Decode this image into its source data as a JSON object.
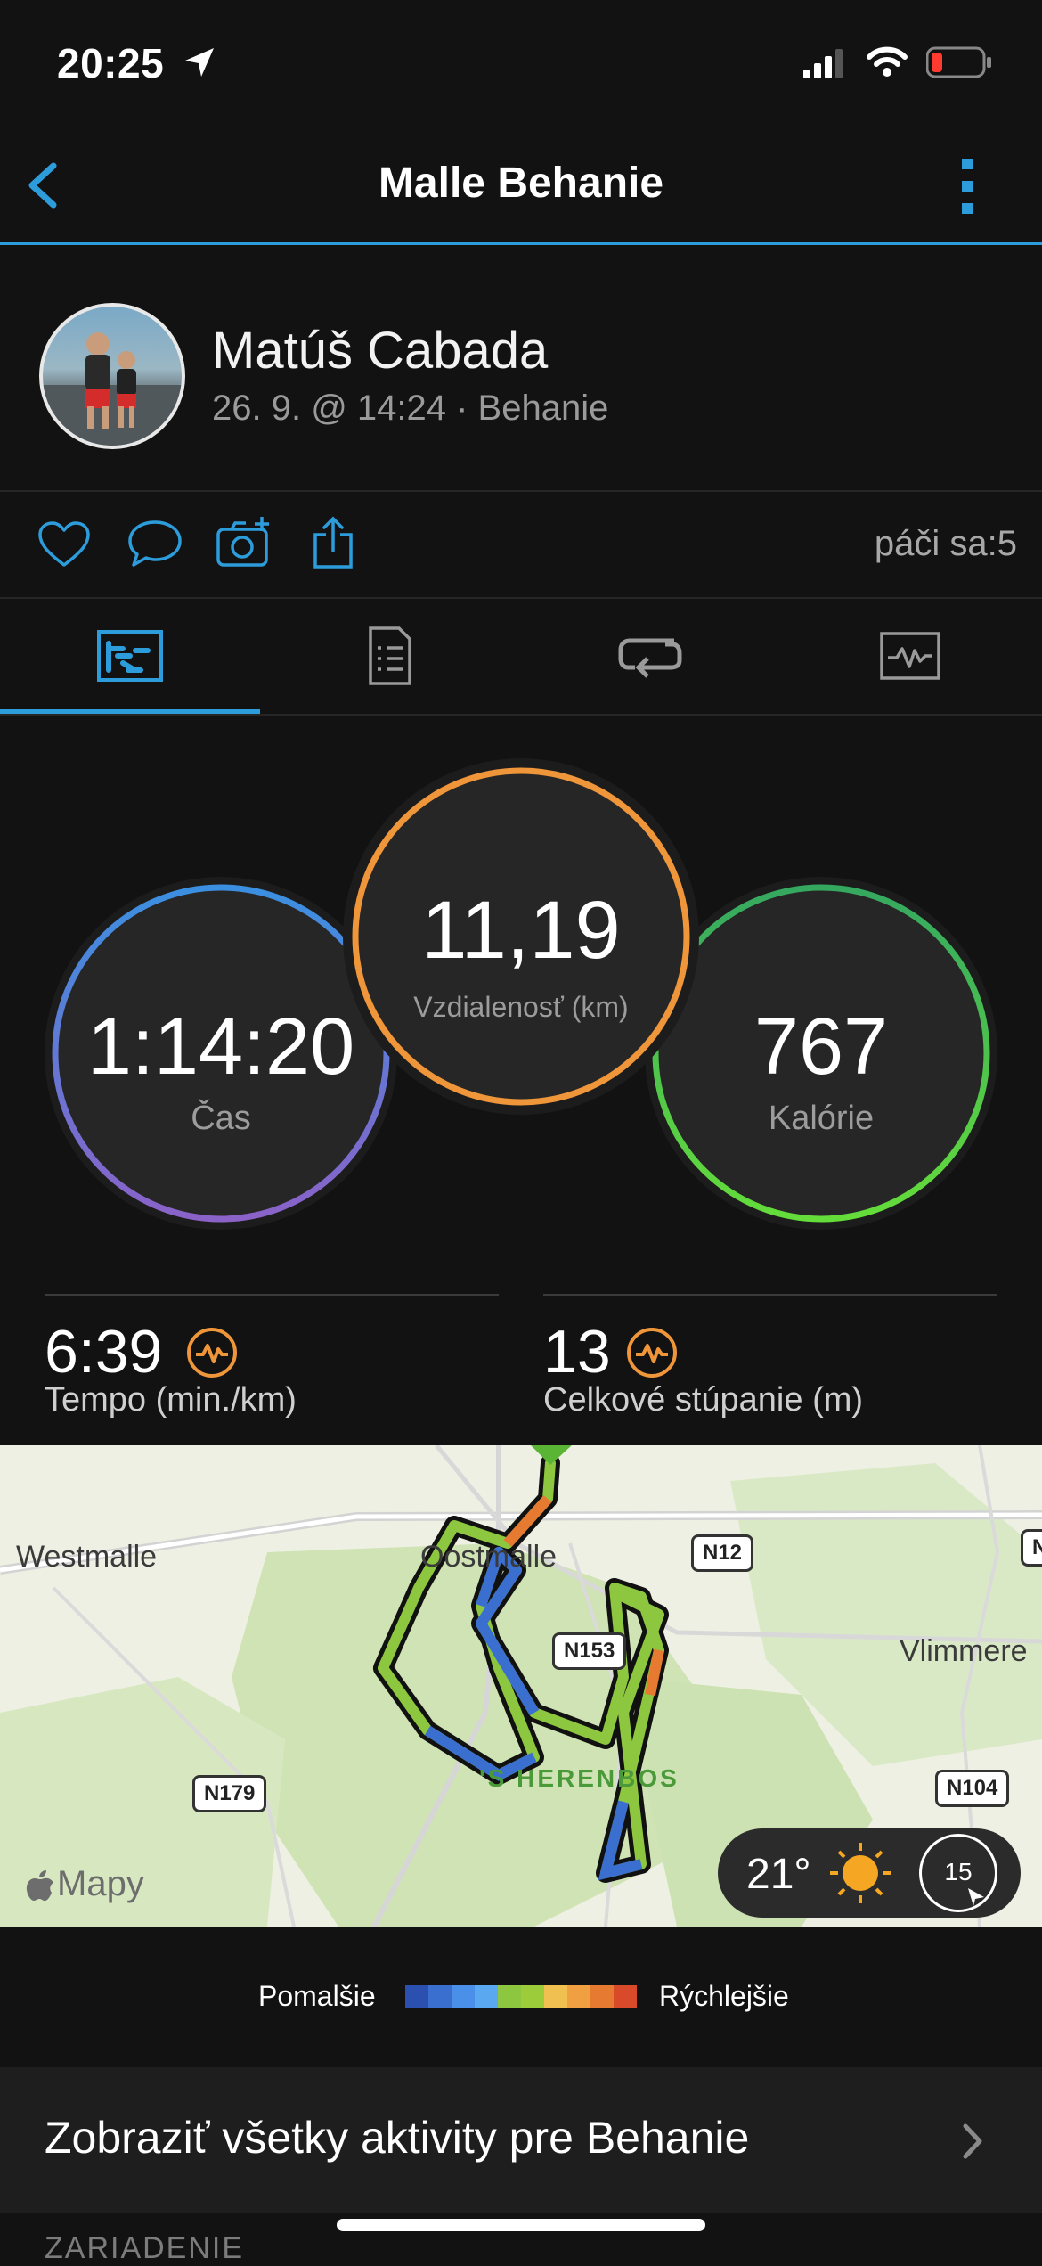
{
  "status_bar": {
    "time": "20:25"
  },
  "header": {
    "title": "Malle Behanie"
  },
  "profile": {
    "name": "Matúš Cabada",
    "meta": "26. 9. @ 14:24 · Behanie"
  },
  "actions": {
    "likes": "páči sa:5"
  },
  "tabs": [
    "overview-tab",
    "details-tab",
    "laps-tab",
    "charts-tab"
  ],
  "stats": {
    "time": {
      "value": "1:14:20",
      "label": "Čas"
    },
    "distance": {
      "value": "11,19",
      "label": "Vzdialenosť (km)"
    },
    "calories": {
      "value": "767",
      "label": "Kalórie"
    },
    "pace": {
      "value": "6:39",
      "label": "Tempo (min./km)"
    },
    "ascent": {
      "value": "13",
      "label": "Celkové stúpanie (m)"
    }
  },
  "map": {
    "places": {
      "westmalle": "Westmalle",
      "oostmalle": "Oostmalle",
      "vlimmeren": "Vlimmere",
      "herenbos": "'S HERENBOS"
    },
    "roads": {
      "n12": "N12",
      "n153": "N153",
      "n179": "N179",
      "n104": "N104",
      "edge": "N"
    },
    "attribution": "Mapy",
    "weather": {
      "temperature": "21°",
      "wind": "15"
    }
  },
  "legend": {
    "slower": "Pomalšie",
    "faster": "Rýchlejšie",
    "colors": [
      "#2b50b0",
      "#3a6fd0",
      "#4a8fe8",
      "#5aa8f0",
      "#8dc63f",
      "#9ccc3a",
      "#f0c050",
      "#f0a040",
      "#e67a30",
      "#d94a2a"
    ]
  },
  "bottom": {
    "all_activities": "Zobraziť všetky aktivity pre Behanie",
    "device_section": "ZARIADENIE"
  }
}
